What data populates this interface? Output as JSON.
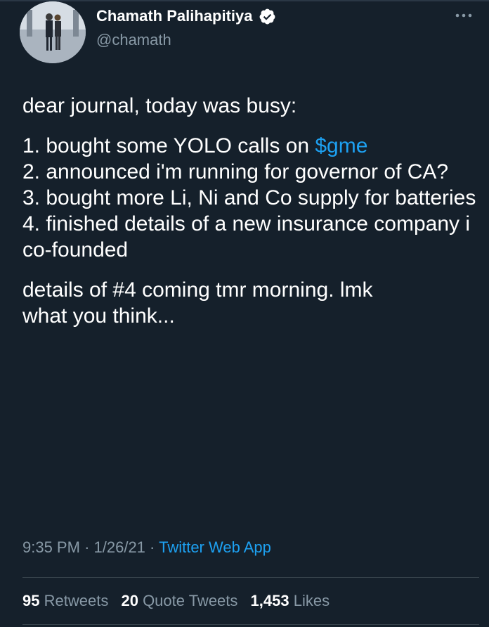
{
  "author": {
    "display_name": "Chamath Palihapitiya",
    "handle": "@chamath",
    "verified": true,
    "avatar_icon": "avatar-photo"
  },
  "tweet": {
    "intro": "dear journal, today was busy:",
    "list": [
      {
        "text": "1. bought some YOLO calls on ",
        "cashtag": "$gme"
      },
      {
        "text": "2. announced i'm running for governor of CA?"
      },
      {
        "text": "3. bought more Li, Ni and Co supply for batteries"
      },
      {
        "text": "4. finished details of a new insurance company i co-founded"
      }
    ],
    "closing_line1": "details of #4 coming tmr morning. lmk",
    "closing_line2": "what you think..."
  },
  "meta": {
    "time": "9:35 PM",
    "separator": "·",
    "date": "1/26/21",
    "source": "Twitter Web App"
  },
  "stats": {
    "retweets_count": "95",
    "retweets_label": "Retweets",
    "quote_count": "20",
    "quote_label": "Quote Tweets",
    "likes_count": "1,453",
    "likes_label": "Likes"
  },
  "colors": {
    "background": "#15202b",
    "text": "#ffffff",
    "secondary": "#8899a6",
    "link": "#1da1f2",
    "divider": "#38444d"
  },
  "icons": {
    "verified": "verified-badge-icon",
    "more": "more-options-icon"
  }
}
